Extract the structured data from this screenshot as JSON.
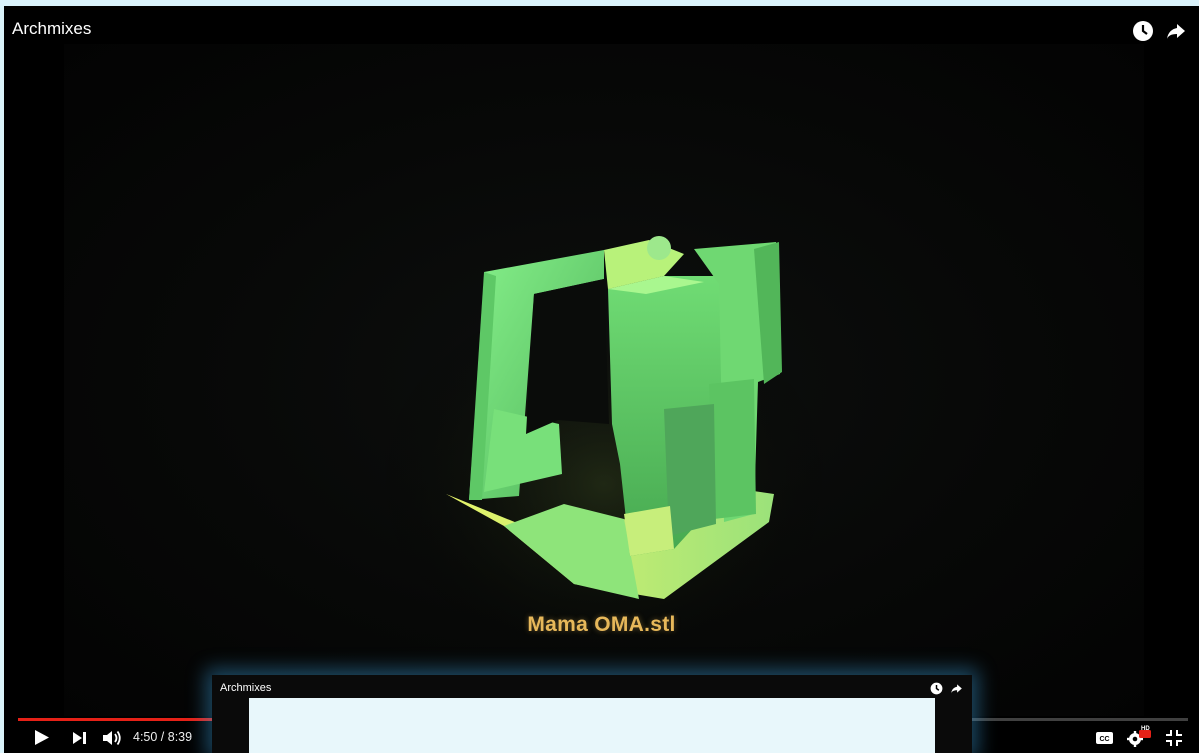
{
  "player": {
    "title": "Archmixes",
    "subtitle": "Mama OMA.stl",
    "time_display": "4:50 / 8:39",
    "progress_fraction": 0.578
  },
  "icons": {
    "watch_later": "clock-icon",
    "share": "share-arrow-icon",
    "play": "play-icon",
    "next": "skip-next-icon",
    "volume": "volume-icon",
    "captions": "cc-icon",
    "settings": "settings-gear-icon",
    "hd_badge": "HD",
    "exit_fullscreen": "exit-fullscreen-icon"
  },
  "mini_player": {
    "title": "Archmixes"
  },
  "colors": {
    "progress": "#e62117",
    "subtitle": "#e7b85a",
    "model_green": "#7ce87c",
    "page_bg": "#daf3fb"
  }
}
